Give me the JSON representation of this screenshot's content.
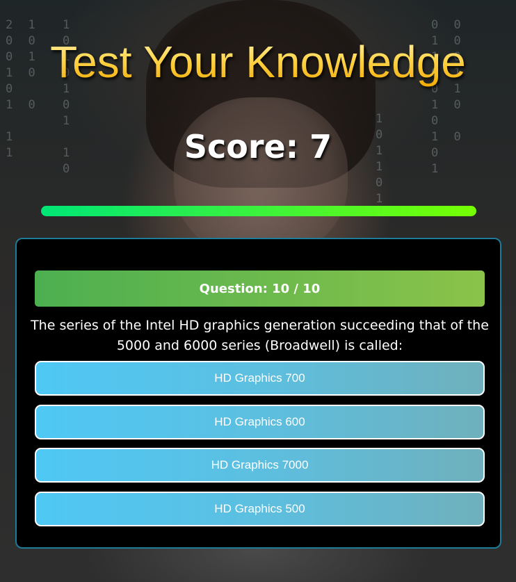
{
  "header": {
    "title": "Test Your Knowledge",
    "score_label": "Score: 7"
  },
  "progress": {
    "value": 1.0,
    "color_start": "#00e676",
    "color_end": "#76ff03"
  },
  "quiz": {
    "question_label": "Question: 10 / 10",
    "question_text": "The series of the Intel HD graphics generation succeeding that of the 5000 and 6000 series (Broadwell) is called:",
    "answers": [
      "HD Graphics 700",
      "HD Graphics 600",
      "HD Graphics 7000",
      "HD Graphics 500"
    ]
  },
  "colors": {
    "title_gold": "#ffd54a",
    "header_green_start": "#4caf50",
    "header_green_end": "#8bc34a",
    "answer_blue": "#4fc8f5",
    "card_border": "#1e7b9a"
  }
}
